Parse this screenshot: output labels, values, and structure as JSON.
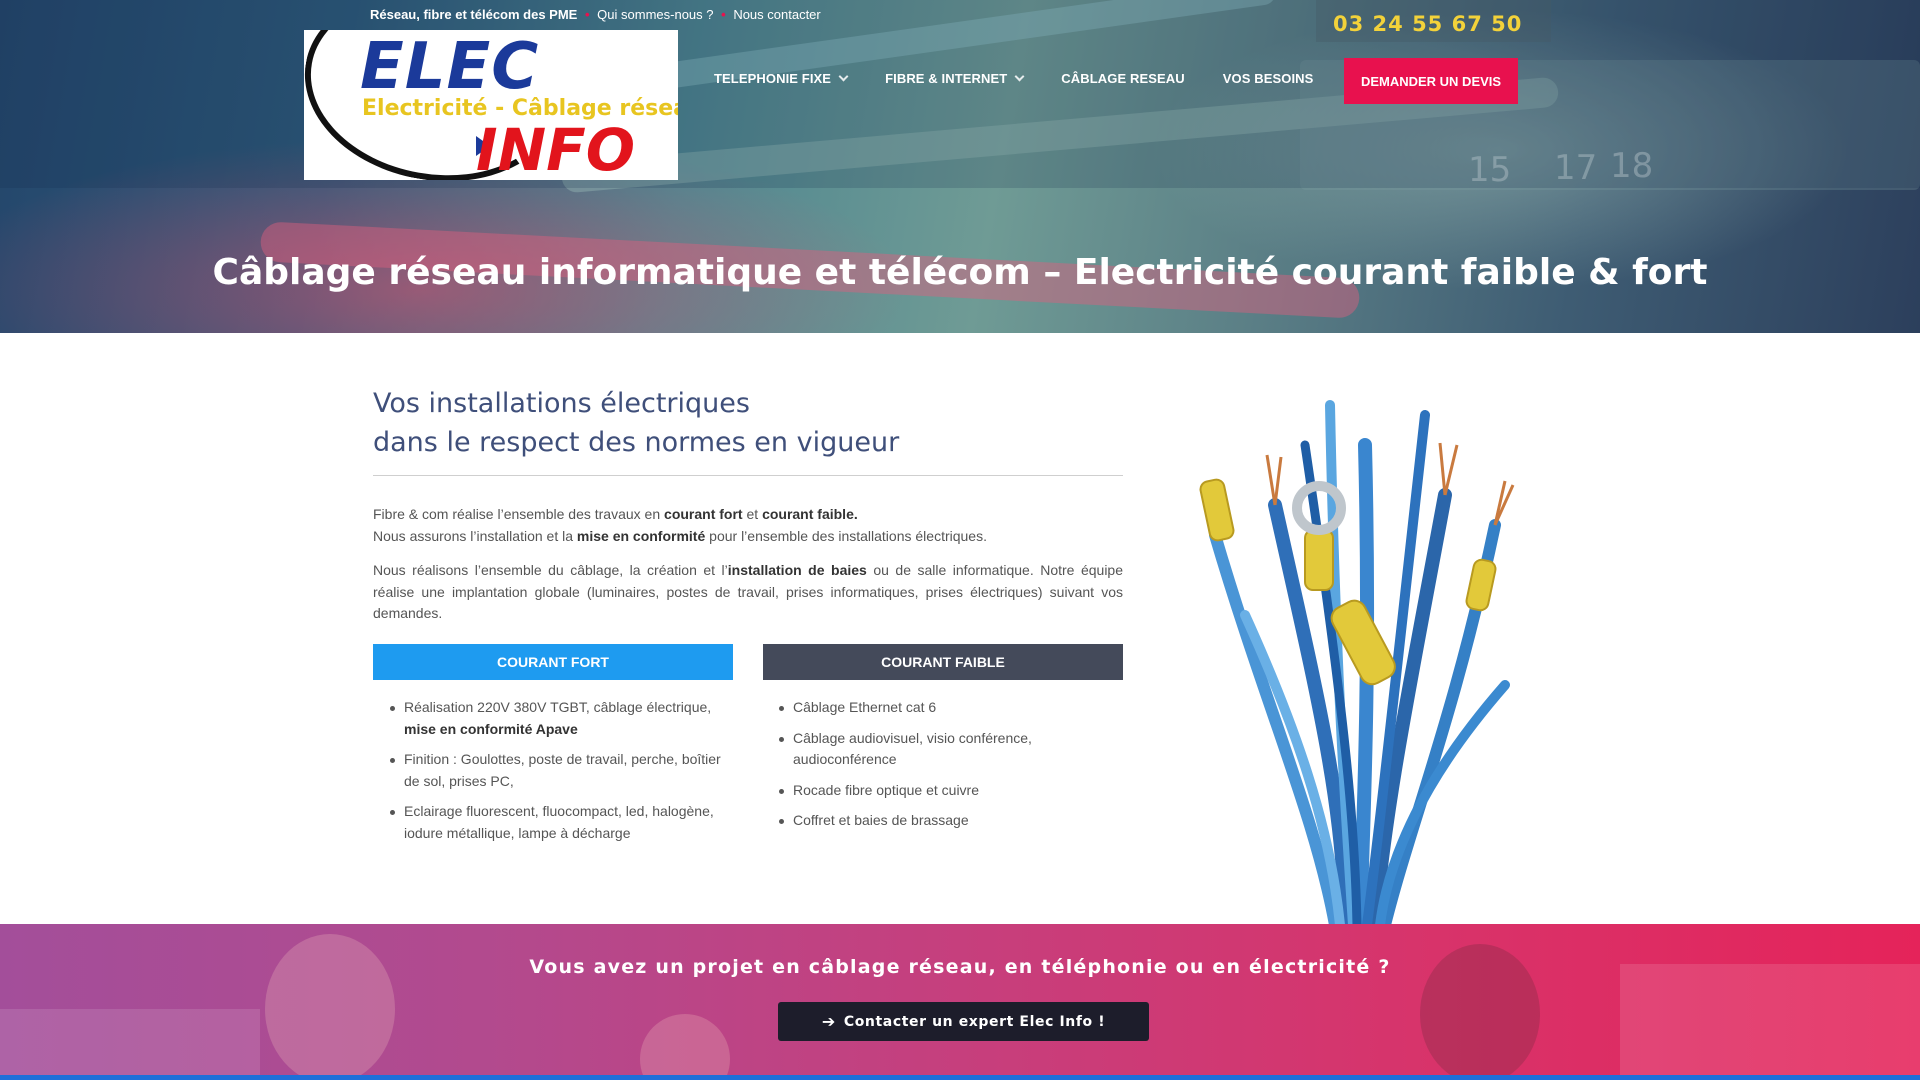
{
  "topbar": {
    "tagline": "Réseau, fibre et télécom des PME",
    "separator": "•",
    "link_about": "Qui sommes-nous ?",
    "link_contact": "Nous contacter"
  },
  "logo": {
    "word1": "ELEC",
    "subtitle": "Electricité - Câblage réseau",
    "word2": "INFO"
  },
  "nav": {
    "items": [
      {
        "label": "TELEPHONIE FIXE"
      },
      {
        "label": "FIBRE & INTERNET"
      },
      {
        "label": "CÂBLAGE RESEAU"
      },
      {
        "label": "VOS BESOINS"
      }
    ]
  },
  "header": {
    "phone": "03 24 55 67 50",
    "devis_label": "DEMANDER UN DEVIS"
  },
  "hero": {
    "title": "Câblage réseau informatique et télécom – Electricité courant faible & fort",
    "port_numbers": [
      "15",
      "17",
      "18"
    ]
  },
  "intro": {
    "title_line1": "Vos installations électriques",
    "title_line2": "dans le respect des normes en vigueur"
  },
  "paragraph1": {
    "a": "Fibre & com réalise l’ensemble des travaux en ",
    "b": "courant fort",
    "c": " et ",
    "d": "courant faible.",
    "e": "Nous assurons l’installation et la ",
    "f": "mise en conformité",
    "g": " pour l’ensemble des installations électriques."
  },
  "paragraph2": {
    "a": "Nous réalisons l’ensemble du câblage, la création et l’",
    "b": "installation de baies",
    "c": " ou de salle informatique. Notre équipe réalise une implantation globale (luminaires, postes de travail, prises informatiques, prises électriques) suivant vos demandes."
  },
  "courant_fort": {
    "heading": "COURANT FORT",
    "items": [
      {
        "text": "Réalisation 220V 380V TGBT, câblage électrique, ",
        "bold": "mise en conformité Apave"
      },
      {
        "text": "Finition : Goulottes, poste de travail, perche, boîtier de sol, prises PC,",
        "bold": ""
      },
      {
        "text": "Eclairage fluorescent, fluocompact, led, halogène, iodure métallique, lampe à décharge",
        "bold": ""
      }
    ]
  },
  "courant_faible": {
    "heading": "COURANT FAIBLE",
    "items": [
      {
        "text": "Câblage Ethernet cat 6"
      },
      {
        "text": "Câblage audiovisuel, visio conférence, audioconférence"
      },
      {
        "text": "Rocade fibre optique et cuivre"
      },
      {
        "text": "Coffret et baies de brassage"
      }
    ]
  },
  "cta": {
    "text": "Vous avez un projet en câblage réseau, en téléphonie ou en électricité ?",
    "button_label": "Contacter un expert Elec Info !",
    "button_icon": "arrow-right-icon"
  },
  "colors": {
    "accent_pink": "#e8114e",
    "phone_yellow": "#f3d23a",
    "fort_blue": "#1e9bf0",
    "faible_grey": "#444a5a",
    "title_navy": "#3f4f7a"
  }
}
